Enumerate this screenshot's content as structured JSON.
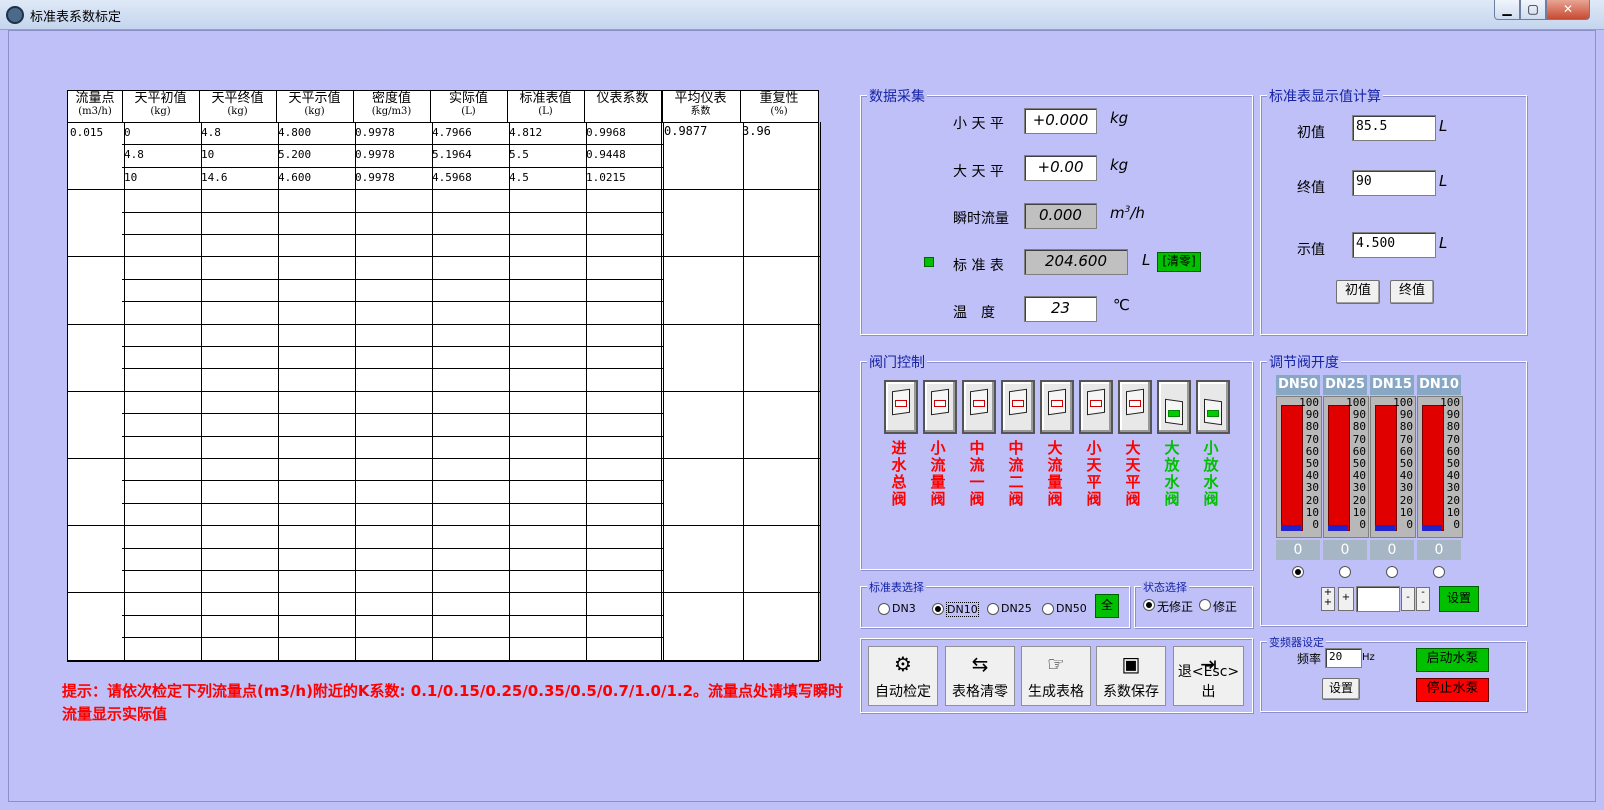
{
  "window": {
    "title": "标准表系数标定"
  },
  "table": {
    "headers": [
      {
        "l1": "流量点",
        "l2": "(m3/h)"
      },
      {
        "l1": "天平初值",
        "l2": "(kg)"
      },
      {
        "l1": "天平终值",
        "l2": "(kg)"
      },
      {
        "l1": "天平示值",
        "l2": "(kg)"
      },
      {
        "l1": "密度值",
        "l2": "(kg/m3)"
      },
      {
        "l1": "实际值",
        "l2": "(L)"
      },
      {
        "l1": "标准表值",
        "l2": "(L)"
      },
      {
        "l1": "仪表系数",
        "l2": ""
      },
      {
        "l1": "平均仪表",
        "l2": "系数"
      },
      {
        "l1": "重复性",
        "l2": "(%)"
      }
    ],
    "flow_point": "0.015",
    "rows": [
      [
        "0",
        "4.8",
        "4.800",
        "0.9978",
        "4.7966",
        "4.812",
        "0.9968"
      ],
      [
        "4.8",
        "10",
        "5.200",
        "0.9978",
        "5.1964",
        "5.5",
        "0.9448"
      ],
      [
        "10",
        "14.6",
        "4.600",
        "0.9978",
        "4.5968",
        "4.5",
        "1.0215"
      ]
    ],
    "avg_coef": "0.9877",
    "repeatability": "3.96"
  },
  "hint": "提示：请依次检定下列流量点(m3/h)附近的K系数: 0.1/0.15/0.25/0.35/0.5/0.7/1.0/1.2。流量点处请填写瞬时流量显示实际值",
  "acq": {
    "title": "数据采集",
    "small_balance_label": "小 天 平",
    "small_balance": "+0.000",
    "small_unit": "kg",
    "big_balance_label": "大 天 平",
    "big_balance": "+0.00",
    "big_unit": "kg",
    "inst_flow_label": "瞬时流量",
    "inst_flow": "0.000",
    "inst_unit": "m",
    "inst_unit_sup": "3",
    "inst_unit_tail": "/h",
    "std_meter_label": "标 准 表",
    "std_meter": "204.600",
    "std_unit": "L",
    "clear_label": "[清零]",
    "temp_label": "温　度",
    "temp": "23",
    "temp_unit": "℃"
  },
  "calc": {
    "title": "标准表显示值计算",
    "init_label": "初值",
    "init_value": "85.5",
    "init_unit": "L",
    "final_label": "终值",
    "final_value": "90",
    "final_unit": "L",
    "show_label": "示值",
    "show_value": "4.500",
    "show_unit": "L",
    "btn_init": "初值",
    "btn_final": "终值"
  },
  "valves": {
    "title": "阀门控制",
    "items": [
      {
        "label": "进水总阀",
        "on": false,
        "color": "#ff0000"
      },
      {
        "label": "小流量阀",
        "on": false,
        "color": "#ff0000"
      },
      {
        "label": "中流一阀",
        "on": false,
        "color": "#ff0000"
      },
      {
        "label": "中流二阀",
        "on": false,
        "color": "#ff0000"
      },
      {
        "label": "大流量阀",
        "on": false,
        "color": "#ff0000"
      },
      {
        "label": "小天平阀",
        "on": false,
        "color": "#ff0000"
      },
      {
        "label": "大天平阀",
        "on": false,
        "color": "#ff0000"
      },
      {
        "label": "大放水阀",
        "on": true,
        "color": "#00c000"
      },
      {
        "label": "小放水阀",
        "on": true,
        "color": "#00c000"
      }
    ]
  },
  "reg": {
    "title": "调节阀开度",
    "gauges": [
      {
        "name": "DN50",
        "value": "0",
        "selected": true
      },
      {
        "name": "DN25",
        "value": "0",
        "selected": false
      },
      {
        "name": "DN15",
        "value": "0",
        "selected": false
      },
      {
        "name": "DN10",
        "value": "0",
        "selected": false
      }
    ],
    "ticks": [
      "100",
      "90",
      "80",
      "70",
      "60",
      "50",
      "40",
      "30",
      "20",
      "10",
      "0"
    ],
    "set_label": "设置"
  },
  "std_select": {
    "title": "标准表选择",
    "options": [
      "DN3",
      "DN10",
      "DN25",
      "DN50"
    ],
    "selected": 1,
    "all_label": "全"
  },
  "state_select": {
    "title": "状态选择",
    "options": [
      "无修正",
      "修正"
    ],
    "selected": 0
  },
  "tools": [
    {
      "label": "自动检定",
      "icon": "gear-icon"
    },
    {
      "label": "表格清零",
      "icon": "swap-icon"
    },
    {
      "label": "生成表格",
      "icon": "hand-icon"
    },
    {
      "label": "系数保存",
      "icon": "save-icon"
    },
    {
      "label": "退<Esc>出",
      "icon": "exit-icon"
    }
  ],
  "vfd": {
    "title": "变频器设定",
    "freq_label": "频率",
    "freq_value": "20",
    "freq_unit": "Hz",
    "set_label": "设置",
    "start_label": "启动水泵",
    "stop_label": "停止水泵"
  }
}
